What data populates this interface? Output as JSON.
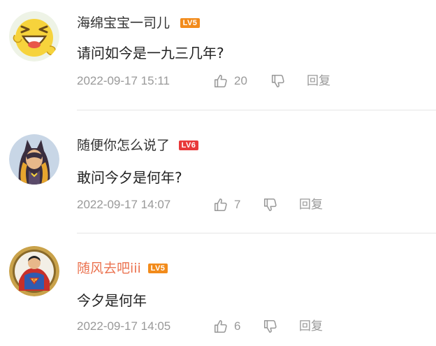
{
  "comments": [
    {
      "username": "海绵宝宝一司儿",
      "level_badge": "LV5",
      "content": "请问如今是一九三几年?",
      "time": "2022-09-17 15:11",
      "likes": "20",
      "reply_label": "回复",
      "badge_color": "#f28b1b"
    },
    {
      "username": "随便你怎么说了",
      "level_badge": "LV6",
      "content": "敢问今夕是何年?",
      "time": "2022-09-17 14:07",
      "likes": "7",
      "reply_label": "回复",
      "badge_color": "#e8383a"
    },
    {
      "username": "随风去吧iii",
      "level_badge": "LV5",
      "content": "今夕是何年",
      "time": "2022-09-17 14:05",
      "likes": "6",
      "reply_label": "回复",
      "badge_color": "#f28b1b",
      "username_color": "#eb7350"
    }
  ],
  "colors": {
    "meta_text": "#999999",
    "username_text": "#333333",
    "content_text": "#222222",
    "divider": "#e5e5e5"
  }
}
